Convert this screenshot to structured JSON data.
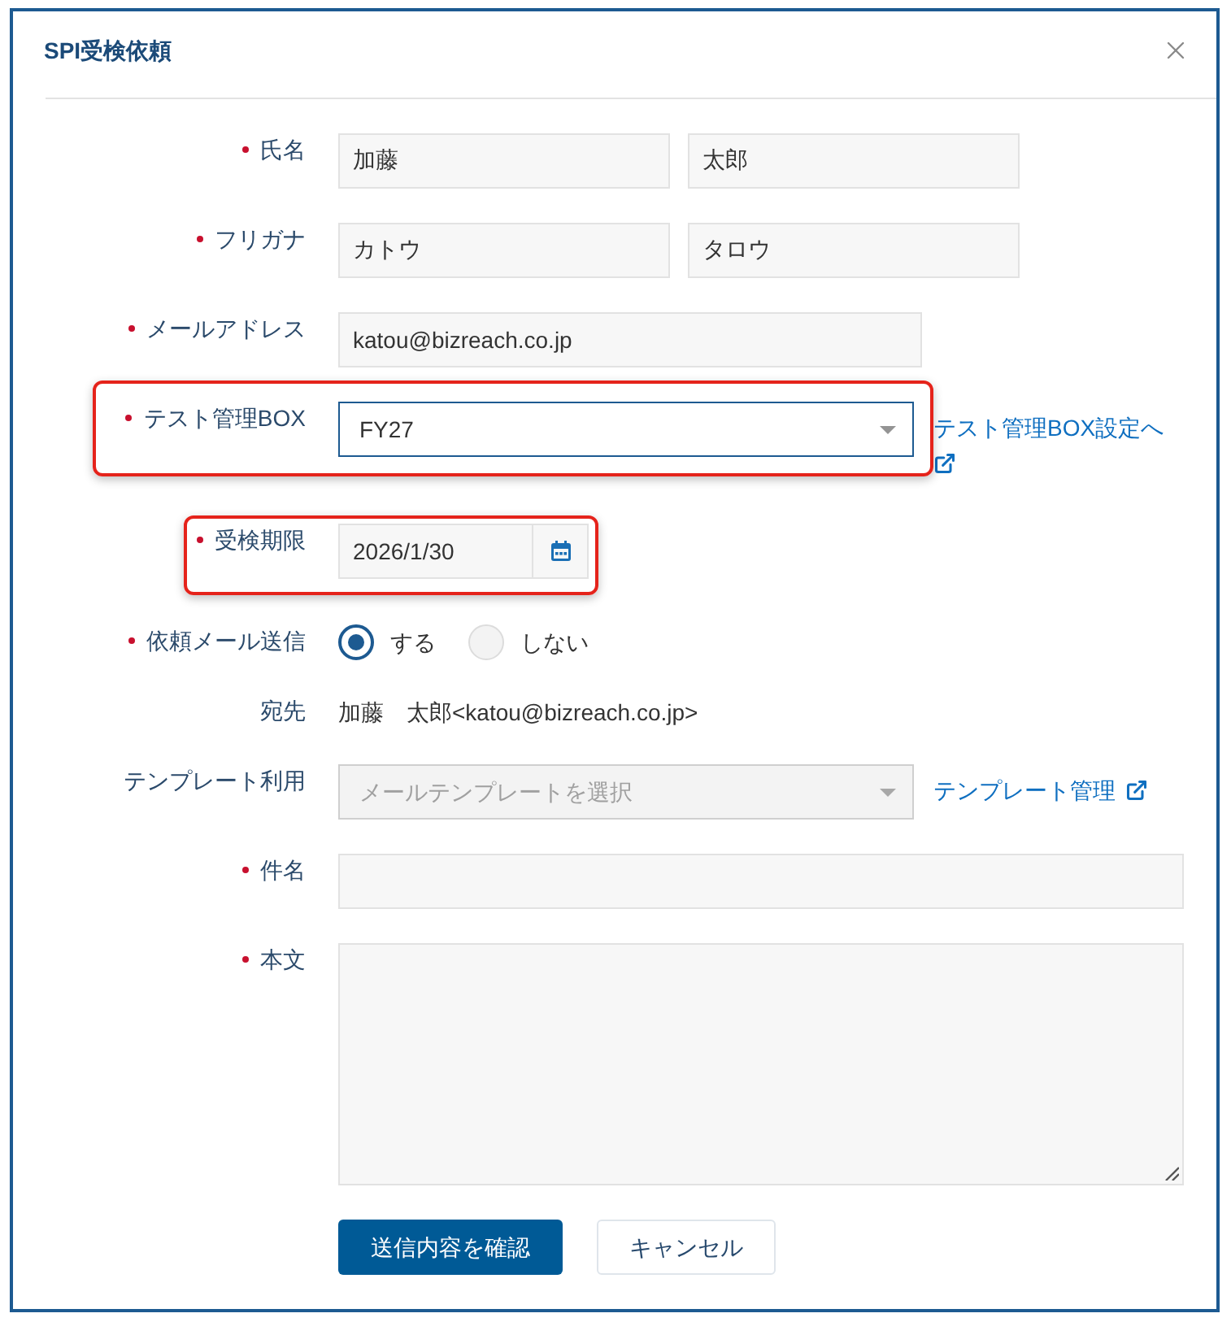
{
  "dialog": {
    "title": "SPI受検依頼"
  },
  "fields": [
    {
      "kind": "name_pair",
      "label": "氏名",
      "required": true,
      "values": [
        "加藤",
        "太郎"
      ]
    },
    {
      "kind": "name_pair",
      "label": "フリガナ",
      "required": true,
      "values": [
        "カトウ",
        "タロウ"
      ]
    },
    {
      "kind": "email",
      "label": "メールアドレス",
      "required": true,
      "value": "katou@bizreach.co.jp"
    },
    {
      "kind": "select",
      "label": "テスト管理BOX",
      "required": true,
      "highlighted": true,
      "value": "FY27",
      "focused": true,
      "disabled": false,
      "link": "テスト管理BOX設定へ"
    },
    {
      "kind": "date",
      "label": "受検期限",
      "required": true,
      "highlighted": true,
      "value": "2026/1/30"
    },
    {
      "kind": "radio",
      "label": "依頼メール送信",
      "required": true,
      "options": [
        {
          "label": "する",
          "selected": true
        },
        {
          "label": "しない",
          "selected": false
        }
      ]
    },
    {
      "kind": "static",
      "label": "宛先",
      "value": "加藤　太郎<katou@bizreach.co.jp>"
    },
    {
      "kind": "select",
      "label": "テンプレート利用",
      "placeholder": "メールテンプレートを選択",
      "focused": false,
      "disabled": true,
      "link": "テンプレート管理"
    },
    {
      "kind": "text",
      "label": "件名",
      "required": true
    },
    {
      "kind": "textarea",
      "label": "本文",
      "required": true
    }
  ],
  "buttons": [
    {
      "kind": "primary",
      "label": "送信内容を確認"
    },
    {
      "kind": "secondary",
      "label": "キャンセル"
    }
  ]
}
